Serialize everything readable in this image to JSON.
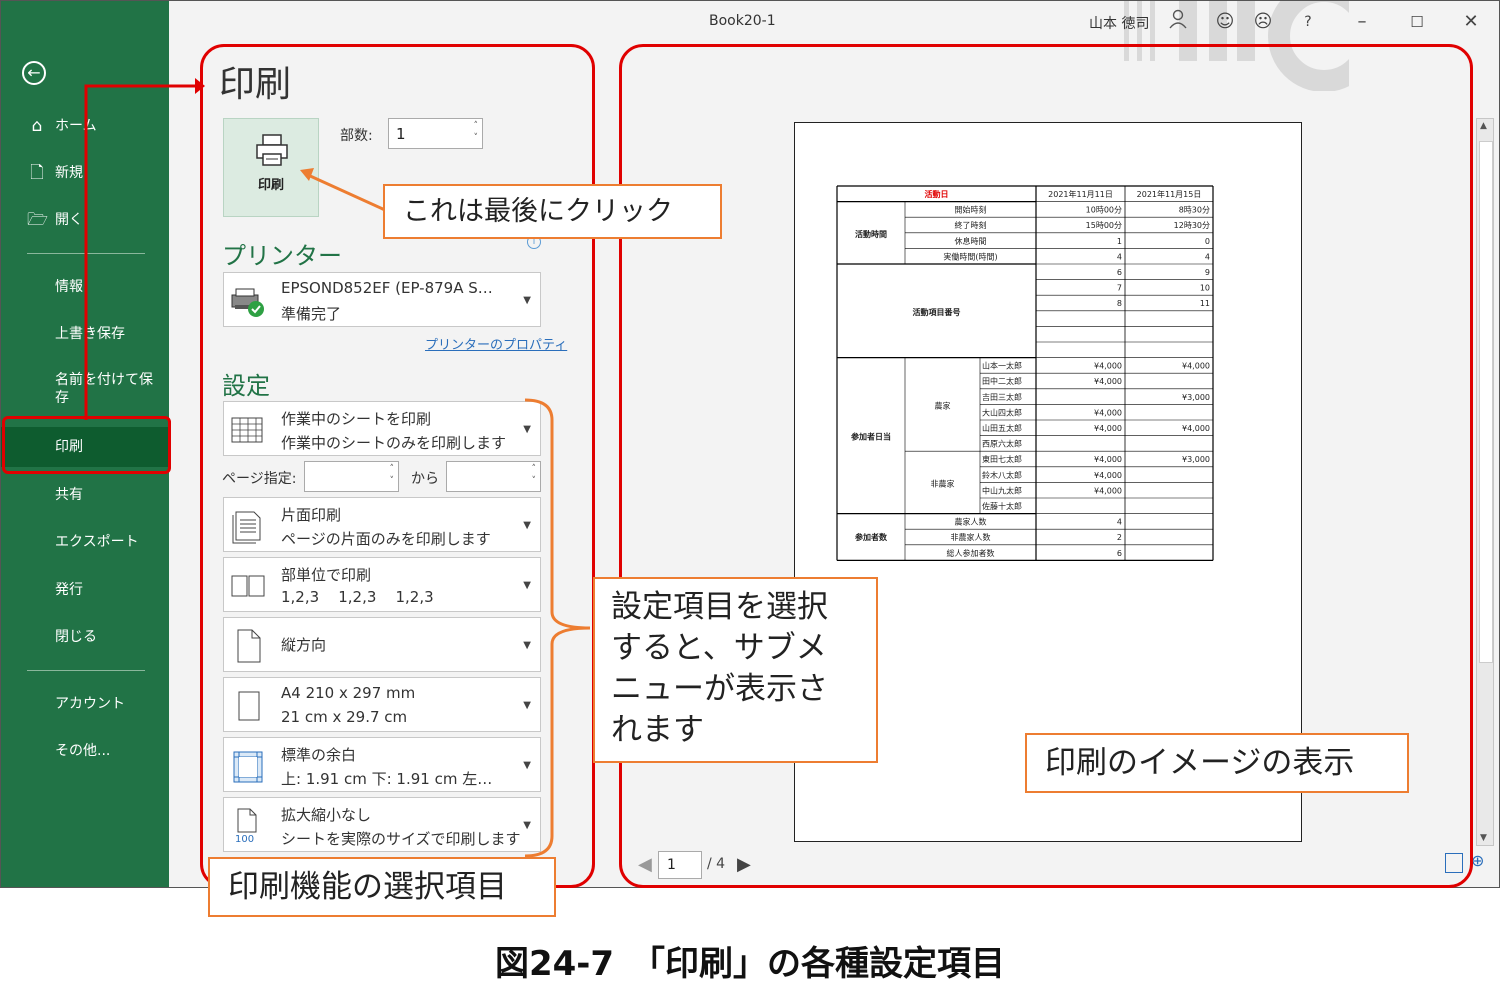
{
  "window": {
    "title": "Book20-1",
    "user": "山本 徳司",
    "icons": [
      "user-icon",
      "smile-icon",
      "frown-icon",
      "help-icon",
      "minimize-icon",
      "restore-icon",
      "close-icon"
    ],
    "help_label": "?"
  },
  "sidebar": {
    "back_icon": "back-arrow-icon",
    "items": [
      {
        "label": "ホーム",
        "icon": "home-icon"
      },
      {
        "label": "新規",
        "icon": "new-document-icon"
      },
      {
        "label": "開く",
        "icon": "open-folder-icon"
      },
      {
        "label": "情報"
      },
      {
        "label": "上書き保存"
      },
      {
        "label": "名前を付けて保存"
      },
      {
        "label": "印刷",
        "active": true
      },
      {
        "label": "共有"
      },
      {
        "label": "エクスポート"
      },
      {
        "label": "発行"
      },
      {
        "label": "閉じる"
      },
      {
        "label": "アカウント"
      },
      {
        "label": "その他..."
      }
    ]
  },
  "print_panel": {
    "title": "印刷",
    "print_button_label": "印刷",
    "copies_label": "部数:",
    "copies_value": "1",
    "printer_section": "プリンター",
    "printer": {
      "name": "EPSOND852EF (EP-879A S…",
      "status": "準備完了"
    },
    "printer_properties_link": "プリンターのプロパティ",
    "settings_section": "設定",
    "settings": [
      {
        "line1": "作業中のシートを印刷",
        "line2": "作業中のシートのみを印刷します",
        "icon": "sheet-grid-icon"
      },
      {
        "line1": "片面印刷",
        "line2": "ページの片面のみを印刷します",
        "icon": "one-sided-icon"
      },
      {
        "line1": "部単位で印刷",
        "line2": "1,2,3    1,2,3    1,2,3",
        "icon": "collate-icon"
      },
      {
        "line1": "縦方向",
        "line2": "",
        "icon": "portrait-icon"
      },
      {
        "line1": "A4 210 x 297 mm",
        "line2": "21 cm x 29.7 cm",
        "icon": "paper-size-icon"
      },
      {
        "line1": "標準の余白",
        "line2": "上: 1.91 cm 下: 1.91 cm 左…",
        "icon": "margins-icon"
      },
      {
        "line1": "拡大縮小なし",
        "line2": "シートを実際のサイズで印刷します",
        "icon": "no-scaling-icon",
        "icon_text": "100"
      }
    ],
    "pages_label": "ページ指定:",
    "pages_to_label": "から"
  },
  "preview": {
    "page_current": "1",
    "page_total": "/ 4",
    "sheet": {
      "header": {
        "label": "活動日",
        "dates": [
          "2021年11月11日",
          "2021年11月15日"
        ]
      },
      "time_group": "活動時間",
      "time_rows": [
        {
          "label": "開始時刻",
          "v1": "10時00分",
          "v2": "8時30分"
        },
        {
          "label": "終了時刻",
          "v1": "15時00分",
          "v2": "12時30分"
        },
        {
          "label": "休息時間",
          "v1": "1",
          "v2": "0"
        },
        {
          "label": "実働時間(時間)",
          "v1": "4",
          "v2": "4"
        }
      ],
      "activity_group": "活動項目番号",
      "activity_rows": [
        {
          "v1": "6",
          "v2": "9"
        },
        {
          "v1": "7",
          "v2": "10"
        },
        {
          "v1": "8",
          "v2": "11"
        },
        {
          "v1": "",
          "v2": ""
        },
        {
          "v1": "",
          "v2": ""
        },
        {
          "v1": "",
          "v2": ""
        }
      ],
      "participants_group": "参加者日当",
      "farmer_label": "農家",
      "nonfarmer_label": "非農家",
      "participants": [
        {
          "name": "山本一太郎",
          "v1": "¥4,000",
          "v2": "¥4,000"
        },
        {
          "name": "田中二太郎",
          "v1": "¥4,000",
          "v2": ""
        },
        {
          "name": "吉田三太郎",
          "v1": "",
          "v2": "¥3,000"
        },
        {
          "name": "大山四太郎",
          "v1": "¥4,000",
          "v2": ""
        },
        {
          "name": "山田五太郎",
          "v1": "¥4,000",
          "v2": "¥4,000"
        },
        {
          "name": "西原六太郎",
          "v1": "",
          "v2": ""
        },
        {
          "name": "東田七太郎",
          "v1": "¥4,000",
          "v2": "¥3,000"
        },
        {
          "name": "鈴木八太郎",
          "v1": "¥4,000",
          "v2": ""
        },
        {
          "name": "中山九太郎",
          "v1": "¥4,000",
          "v2": ""
        },
        {
          "name": "佐藤十太郎",
          "v1": "",
          "v2": ""
        }
      ],
      "count_group": "参加者数",
      "counts": [
        {
          "label": "農家人数",
          "v1": "4",
          "v2": ""
        },
        {
          "label": "非農家人数",
          "v1": "2",
          "v2": ""
        },
        {
          "label": "総人参加者数",
          "v1": "6",
          "v2": ""
        }
      ]
    }
  },
  "annotations": {
    "click_last": "これは最後にクリック",
    "submenu_note": [
      "設定項目を選択",
      "すると、サブメ",
      "ニューが表示さ",
      "れます"
    ],
    "print_functions": "印刷機能の選択項目",
    "preview_note": "印刷のイメージの表示",
    "accent_color": "#ed7d31",
    "highlight_color": "#e00000"
  },
  "caption": "図24-7　「印刷」の各種設定項目"
}
